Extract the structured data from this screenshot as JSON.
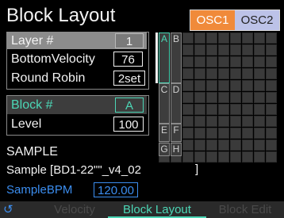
{
  "title": "Block Layout",
  "osc_tabs": [
    {
      "label": "OSC1",
      "active": true
    },
    {
      "label": "OSC2",
      "active": false
    }
  ],
  "params": {
    "layer_label": "Layer #",
    "layer_value": "1",
    "bottom_velocity_label": "BottomVelocity",
    "bottom_velocity_value": "76",
    "round_robin_label": "Round Robin",
    "round_robin_value": "2set",
    "block_label": "Block #",
    "block_value": "A",
    "level_label": "Level",
    "level_value": "100"
  },
  "sample": {
    "heading": "SAMPLE",
    "name": "Sample [BD1-22\"\"_v4_02",
    "bracket": "]",
    "bpm_label": "SampleBPM",
    "bpm_value": "120.00"
  },
  "grid": {
    "blocks": [
      {
        "letter": "A",
        "active": true
      },
      {
        "letter": "B",
        "active": false
      },
      {
        "letter": "C",
        "active": false
      },
      {
        "letter": "D",
        "active": false
      },
      {
        "letter": "E",
        "active": false
      },
      {
        "letter": "F",
        "active": false
      },
      {
        "letter": "G",
        "active": false
      },
      {
        "letter": "H",
        "active": false
      }
    ]
  },
  "bottom_tabs": {
    "velocity": "Velocity",
    "block_layout": "Block Layout",
    "block_edit": "Block Edit"
  },
  "colors": {
    "accent": "#4cd7b6",
    "osc1": "#f08a3a",
    "osc2": "#bcc2e8",
    "bpm": "#3c8ef0"
  },
  "icons": {
    "refresh": "refresh-icon"
  }
}
